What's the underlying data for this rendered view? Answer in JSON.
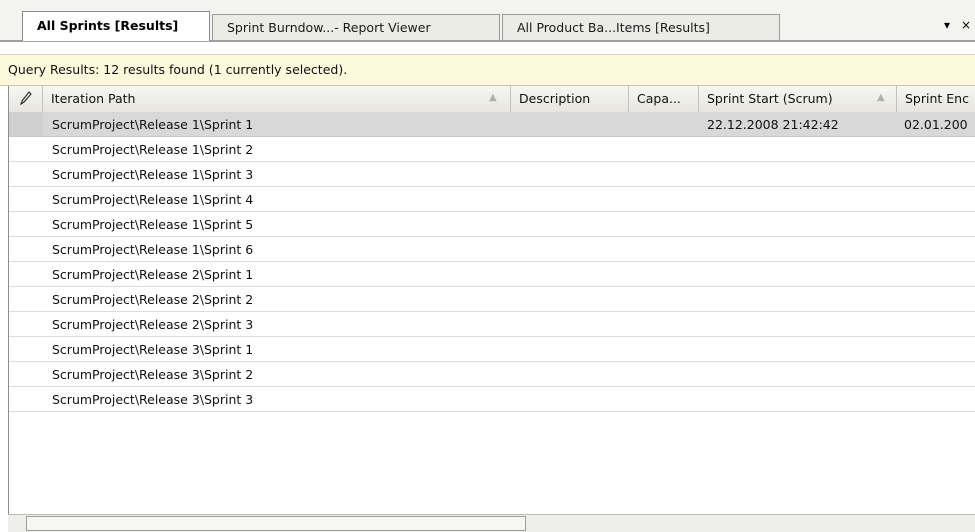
{
  "tabs": [
    {
      "label": "All Sprints [Results]",
      "active": true
    },
    {
      "label": "Sprint Burndow...- Report Viewer",
      "active": false
    },
    {
      "label": "All Product Ba...Items [Results]",
      "active": false
    }
  ],
  "tabstrip": {
    "dropdown_glyph": "▾",
    "close_glyph": "×"
  },
  "status": {
    "text": "Query Results: 12 results found (1 currently selected)."
  },
  "columns": [
    {
      "label": "",
      "icon": "pencil-icon"
    },
    {
      "label": "Iteration Path",
      "sort": "▲"
    },
    {
      "label": "Description"
    },
    {
      "label": "Capa..."
    },
    {
      "label": "Sprint Start (Scrum)",
      "sort": "▲"
    },
    {
      "label": "Sprint Enc"
    }
  ],
  "rows": [
    {
      "path": "ScrumProject\\Release 1\\Sprint 1",
      "start": "22.12.2008 21:42:42",
      "end": "02.01.200",
      "selected": true
    },
    {
      "path": "ScrumProject\\Release 1\\Sprint 2",
      "start": "",
      "end": ""
    },
    {
      "path": "ScrumProject\\Release 1\\Sprint 3",
      "start": "",
      "end": ""
    },
    {
      "path": "ScrumProject\\Release 1\\Sprint 4",
      "start": "",
      "end": ""
    },
    {
      "path": "ScrumProject\\Release 1\\Sprint 5",
      "start": "",
      "end": ""
    },
    {
      "path": "ScrumProject\\Release 1\\Sprint 6",
      "start": "",
      "end": ""
    },
    {
      "path": "ScrumProject\\Release 2\\Sprint 1",
      "start": "",
      "end": ""
    },
    {
      "path": "ScrumProject\\Release 2\\Sprint 2",
      "start": "",
      "end": ""
    },
    {
      "path": "ScrumProject\\Release 2\\Sprint 3",
      "start": "",
      "end": ""
    },
    {
      "path": "ScrumProject\\Release 3\\Sprint 1",
      "start": "",
      "end": ""
    },
    {
      "path": "ScrumProject\\Release 3\\Sprint 2",
      "start": "",
      "end": ""
    },
    {
      "path": "ScrumProject\\Release 3\\Sprint 3",
      "start": "",
      "end": ""
    }
  ]
}
